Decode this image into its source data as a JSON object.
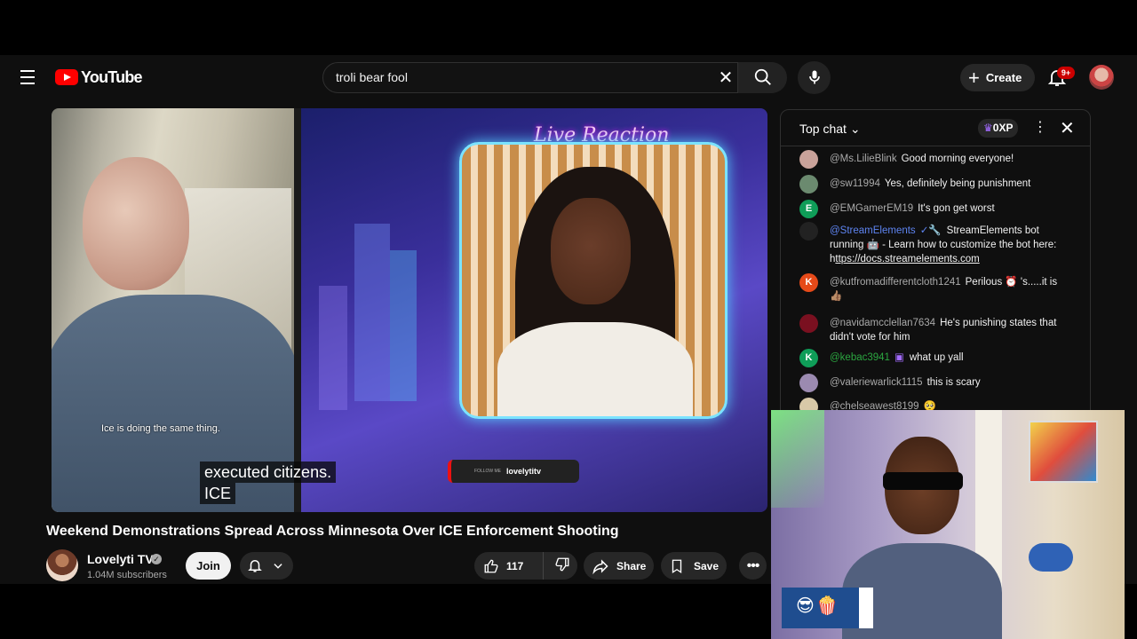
{
  "masthead": {
    "logo_text": "YouTube",
    "search_value": "troli bear fool",
    "create_label": "Create",
    "notifications_badge": "9+"
  },
  "video": {
    "left_caption": "Ice is doing the same thing.",
    "overlay_title": "Live Reaction",
    "handle_small": "FOLLOW ME",
    "handle": "lovelytitv",
    "subtitle_line1": "executed citizens.",
    "subtitle_line2": "ICE"
  },
  "meta": {
    "title": "Weekend Demonstrations Spread Across Minnesota Over ICE Enforcement Shooting",
    "channel_name": "Lovelyti TV",
    "subscribers": "1.04M subscribers",
    "join_label": "Join",
    "like_count": "117",
    "share_label": "Share",
    "save_label": "Save"
  },
  "chat": {
    "header_label": "Top chat",
    "xp_label": "0XP",
    "messages": [
      {
        "author": "@Ms.LilieBlink",
        "text": "Good morning everyone!",
        "avatar": "",
        "avatar_color": "#c9a29a",
        "role": "normal"
      },
      {
        "author": "@sw11994",
        "text": "Yes, definitely being punishment",
        "avatar": "",
        "avatar_color": "#6b8a6f",
        "role": "normal"
      },
      {
        "author": "@EMGamerEM19",
        "text": "It's gon get worst",
        "avatar": "E",
        "avatar_color": "#0f9d58",
        "role": "normal"
      },
      {
        "author": "@StreamElements",
        "text": "StreamElements bot running 🤖 - Learn how to customize the bot here: h",
        "link": "ttps://docs.streamelements.com",
        "avatar": "",
        "avatar_color": "#222",
        "role": "mod"
      },
      {
        "author": "@kutfromadifferentcloth1241",
        "text": "Perilous ⏰ 's.....it is 👍🏽",
        "avatar": "K",
        "avatar_color": "#e64a19",
        "role": "normal"
      },
      {
        "author": "@navidamcclellan7634",
        "text": "He's punishing states that didn't vote for him",
        "avatar": "",
        "avatar_color": "#7a1020",
        "role": "normal"
      },
      {
        "author": "@kebac3941",
        "text": "what up yall",
        "avatar": "K",
        "avatar_color": "#0f9d58",
        "role": "member"
      },
      {
        "author": "@valeriewarlick1115",
        "text": "this is scary",
        "avatar": "",
        "avatar_color": "#9b8ab0",
        "role": "normal"
      },
      {
        "author": "@chelseawest8199",
        "text": "🥺",
        "avatar": "",
        "avatar_color": "#d8c9a8",
        "role": "normal"
      }
    ]
  },
  "webcam": {
    "emoji_label": "😎🍿"
  }
}
